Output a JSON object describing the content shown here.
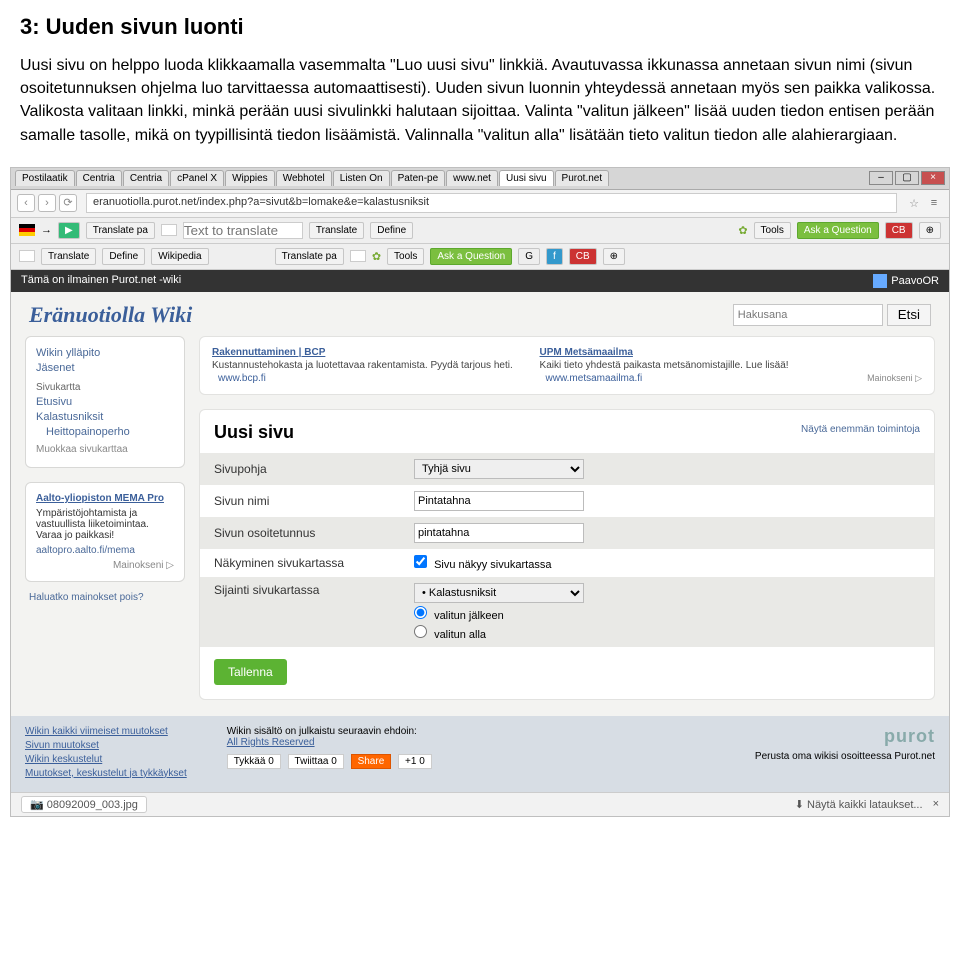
{
  "doc": {
    "heading": "3: Uuden sivun luonti",
    "para1": "Uusi sivu on helppo luoda klikkaamalla vasemmalta \"Luo uusi sivu\" linkkiä. Avautuvassa ikkunassa annetaan sivun nimi (sivun osoitetunnuksen ohjelma luo tarvittaessa automaattisesti). Uuden sivun luonnin yhteydessä annetaan myös sen paikka valikossa. Valikosta valitaan linkki, minkä perään uusi sivulinkki halutaan sijoittaa. Valinta \"valitun jälkeen\" lisää uuden tiedon entisen perään samalle tasolle, mikä on tyypillisintä tiedon lisäämistä. Valinnalla \"valitun alla\" lisätään tieto valitun tiedon alle alahierargiaan."
  },
  "tabs": [
    "Postilaatik",
    "Centria",
    "Centria",
    "cPanel X",
    "Wippies",
    "Webhotel",
    "Listen On",
    "Paten-pe",
    "www.net",
    "Uusi sivu",
    "Purot.net"
  ],
  "activeTab": 9,
  "url": "eranuotiolla.purot.net/index.php?a=sivut&b=lomake&e=kalastusniksit",
  "toolbar": {
    "translate": "Translate pa",
    "textToTranslate": "Text to translate",
    "translateBtn": "Translate",
    "define": "Define",
    "wikipedia": "Wikipedia",
    "tools": "Tools",
    "ask": "Ask a Question"
  },
  "blackbar": {
    "left": "Tämä on ilmainen Purot.net -wiki",
    "user": "PaavoOR"
  },
  "wikiTitle": "Eränuotiolla Wiki",
  "search": {
    "placeholder": "Hakusana",
    "btn": "Etsi"
  },
  "sidebar": {
    "admin": "Wikin ylläpito",
    "members": "Jäsenet",
    "sitemap": "Sivukartta",
    "items": [
      "Etusivu",
      "Kalastusniksit",
      "Heittopainoperho"
    ],
    "edit": "Muokkaa sivukarttaa"
  },
  "sidead": {
    "title": "Aalto-yliopiston MEMA Pro",
    "text": "Ympäristöjohtamista ja vastuullista liiketoimintaa. Varaa jo paikkasi!",
    "url": "aaltopro.aalto.fi/mema",
    "mark": "Mainokseni ▷"
  },
  "removeads": "Haluatko mainokset pois?",
  "ads": [
    {
      "title": "Rakennuttaminen | BCP",
      "text": "Kustannustehokasta ja luotettavaa rakentamista. Pyydä tarjous heti.",
      "url": "www.bcp.fi"
    },
    {
      "title": "UPM Metsämaailma",
      "text": "Kaiki tieto yhdestä paikasta metsänomistajille. Lue lisää!",
      "url": "www.metsamaailma.fi"
    }
  ],
  "adsmark": "Mainokseni ▷",
  "form": {
    "panelTitle": "Uusi sivu",
    "showmore": "Näytä enemmän toimintoja",
    "template_lbl": "Sivupohja",
    "template_val": "Tyhjä sivu",
    "name_lbl": "Sivun nimi",
    "name_val": "Pintatahna",
    "slug_lbl": "Sivun osoitetunnus",
    "slug_val": "pintatahna",
    "visibility_lbl": "Näkyminen sivukartassa",
    "visibility_cb": "Sivu näkyy sivukartassa",
    "location_lbl": "Sijainti sivukartassa",
    "location_val": "• Kalastusniksit",
    "after": "valitun jälkeen",
    "under": "valitun alla",
    "save": "Tallenna"
  },
  "footer": {
    "links1": [
      "Wikin kaikki viimeiset muutokset",
      "Sivun muutokset",
      "Wikin keskustelut",
      "Muutokset, keskustelut ja tykkäykset"
    ],
    "pubtext": "Wikin sisältö on julkaistu seuraavin ehdoin:",
    "publink": "All Rights Reserved",
    "like": "Tykkää",
    "likeN": "0",
    "tweet": "Twiittaa",
    "tweetN": "0",
    "share": "Share",
    "plus": "+1",
    "plusN": "0",
    "brand": "purot",
    "start": "Perusta oma wikisi osoitteessa Purot.net"
  },
  "dl": {
    "file": "08092009_003.jpg",
    "all": "Näytä kaikki lataukset..."
  }
}
